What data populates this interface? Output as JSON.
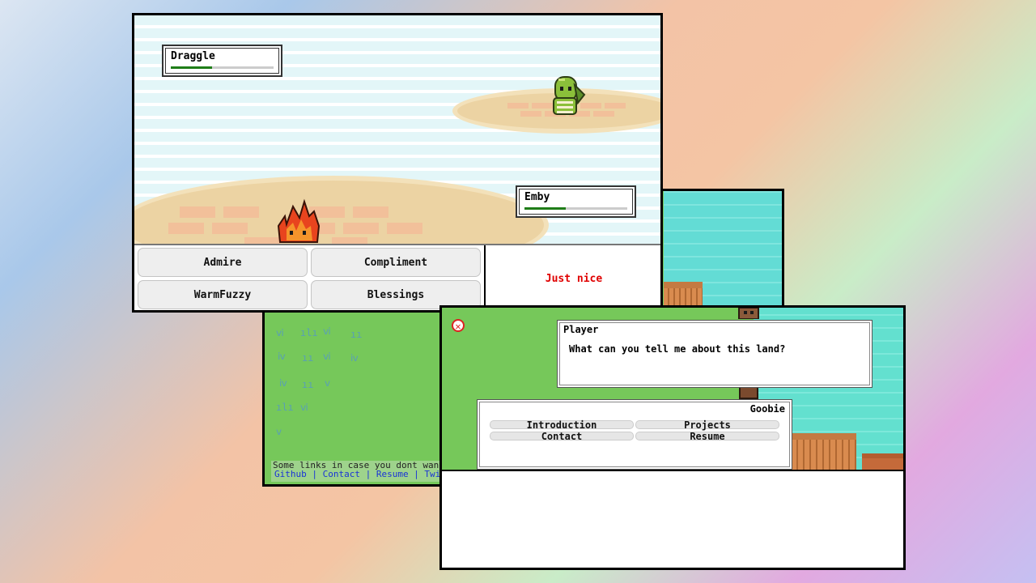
{
  "world": {
    "footer_note": "Some links in case you dont want",
    "footer_links": "Github | Contact | Resume | Twit"
  },
  "battle": {
    "enemy": {
      "name": "Draggle",
      "hp_fraction": 0.4
    },
    "player": {
      "name": "Emby",
      "hp_fraction": 0.4
    },
    "moves": [
      "Admire",
      "Compliment",
      "WarmFuzzy",
      "Blessings"
    ],
    "result_text": "Just nice",
    "result_color": "#e00000"
  },
  "dialog": {
    "speaker": "Player",
    "line": "What can you tell me about this land?",
    "npc_name": "Goobie",
    "options": [
      "Introduction",
      "Projects",
      "Contact",
      "Resume"
    ]
  },
  "colors": {
    "grass": "#76c85a",
    "sea": "#63dcd5",
    "hp_fill": "#1f7d18"
  },
  "icons": [
    "close-icon",
    "fire-sprite",
    "dragon-sprite",
    "npc-sprite"
  ]
}
